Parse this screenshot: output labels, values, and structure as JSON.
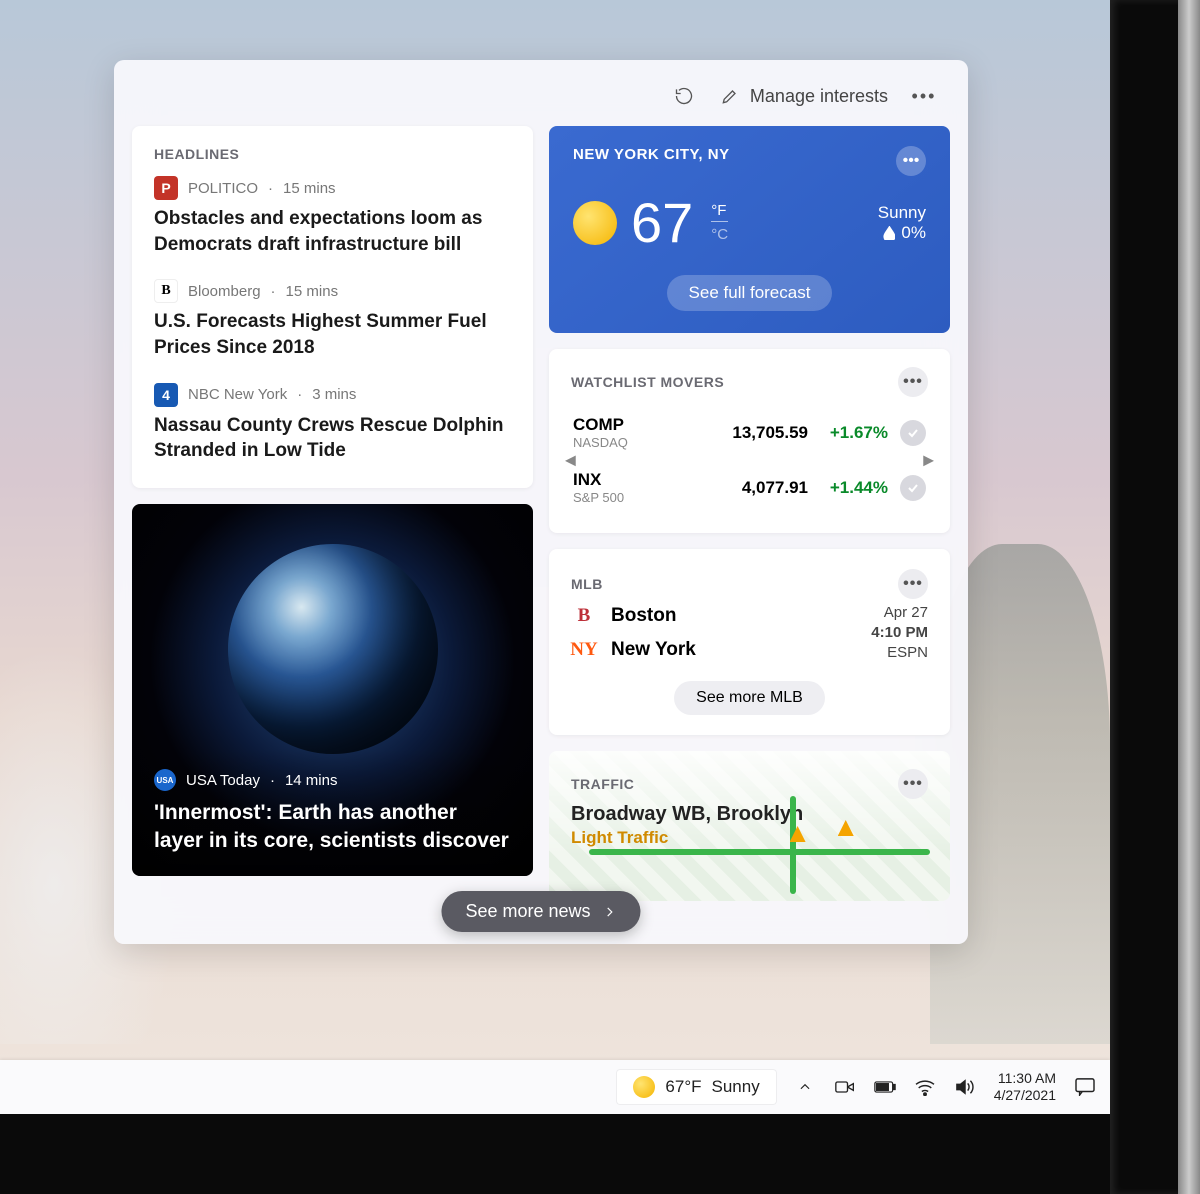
{
  "header": {
    "manage_label": "Manage interests"
  },
  "headlines": {
    "title": "HEADLINES",
    "items": [
      {
        "badge_text": "P",
        "badge_bg": "#c33328",
        "source": "POLITICO",
        "time": "15 mins",
        "title": "Obstacles and expectations loom as Democrats draft infrastructure bill"
      },
      {
        "badge_text": "B",
        "badge_bg": "#000000",
        "source": "Bloomberg",
        "time": "15 mins",
        "title": "U.S. Forecasts Highest Summer Fuel Prices Since 2018"
      },
      {
        "badge_text": "4",
        "badge_bg": "#1759b3",
        "source": "NBC New York",
        "time": "3 mins",
        "title": "Nassau County Crews Rescue Dolphin Stranded in Low Tide"
      }
    ]
  },
  "hero": {
    "source": "USA Today",
    "time": "14 mins",
    "title": "'Innermost': Earth has another layer in its core, scientists discover"
  },
  "weather": {
    "location": "NEW YORK CITY, NY",
    "temp": "67",
    "unit_f": "°F",
    "unit_c": "°C",
    "condition": "Sunny",
    "precip": "0%",
    "button": "See full forecast"
  },
  "watchlist": {
    "title": "WATCHLIST MOVERS",
    "items": [
      {
        "symbol": "COMP",
        "name": "NASDAQ",
        "value": "13,705.59",
        "change": "+1.67%"
      },
      {
        "symbol": "INX",
        "name": "S&P 500",
        "value": "4,077.91",
        "change": "+1.44%"
      }
    ]
  },
  "mlb": {
    "title": "MLB",
    "teams": [
      {
        "badge": "B",
        "color": "#bd3039",
        "name": "Boston"
      },
      {
        "badge": "NY",
        "color": "#ff5910",
        "name": "New York"
      }
    ],
    "date": "Apr 27",
    "time": "4:10 PM",
    "network": "ESPN",
    "button": "See more MLB"
  },
  "traffic": {
    "title": "TRAFFIC",
    "road": "Broadway WB, Brooklyn",
    "status": "Light Traffic"
  },
  "more_news": "See more news",
  "taskbar": {
    "temp": "67°F",
    "cond": "Sunny",
    "time": "11:30 AM",
    "date": "4/27/2021"
  }
}
